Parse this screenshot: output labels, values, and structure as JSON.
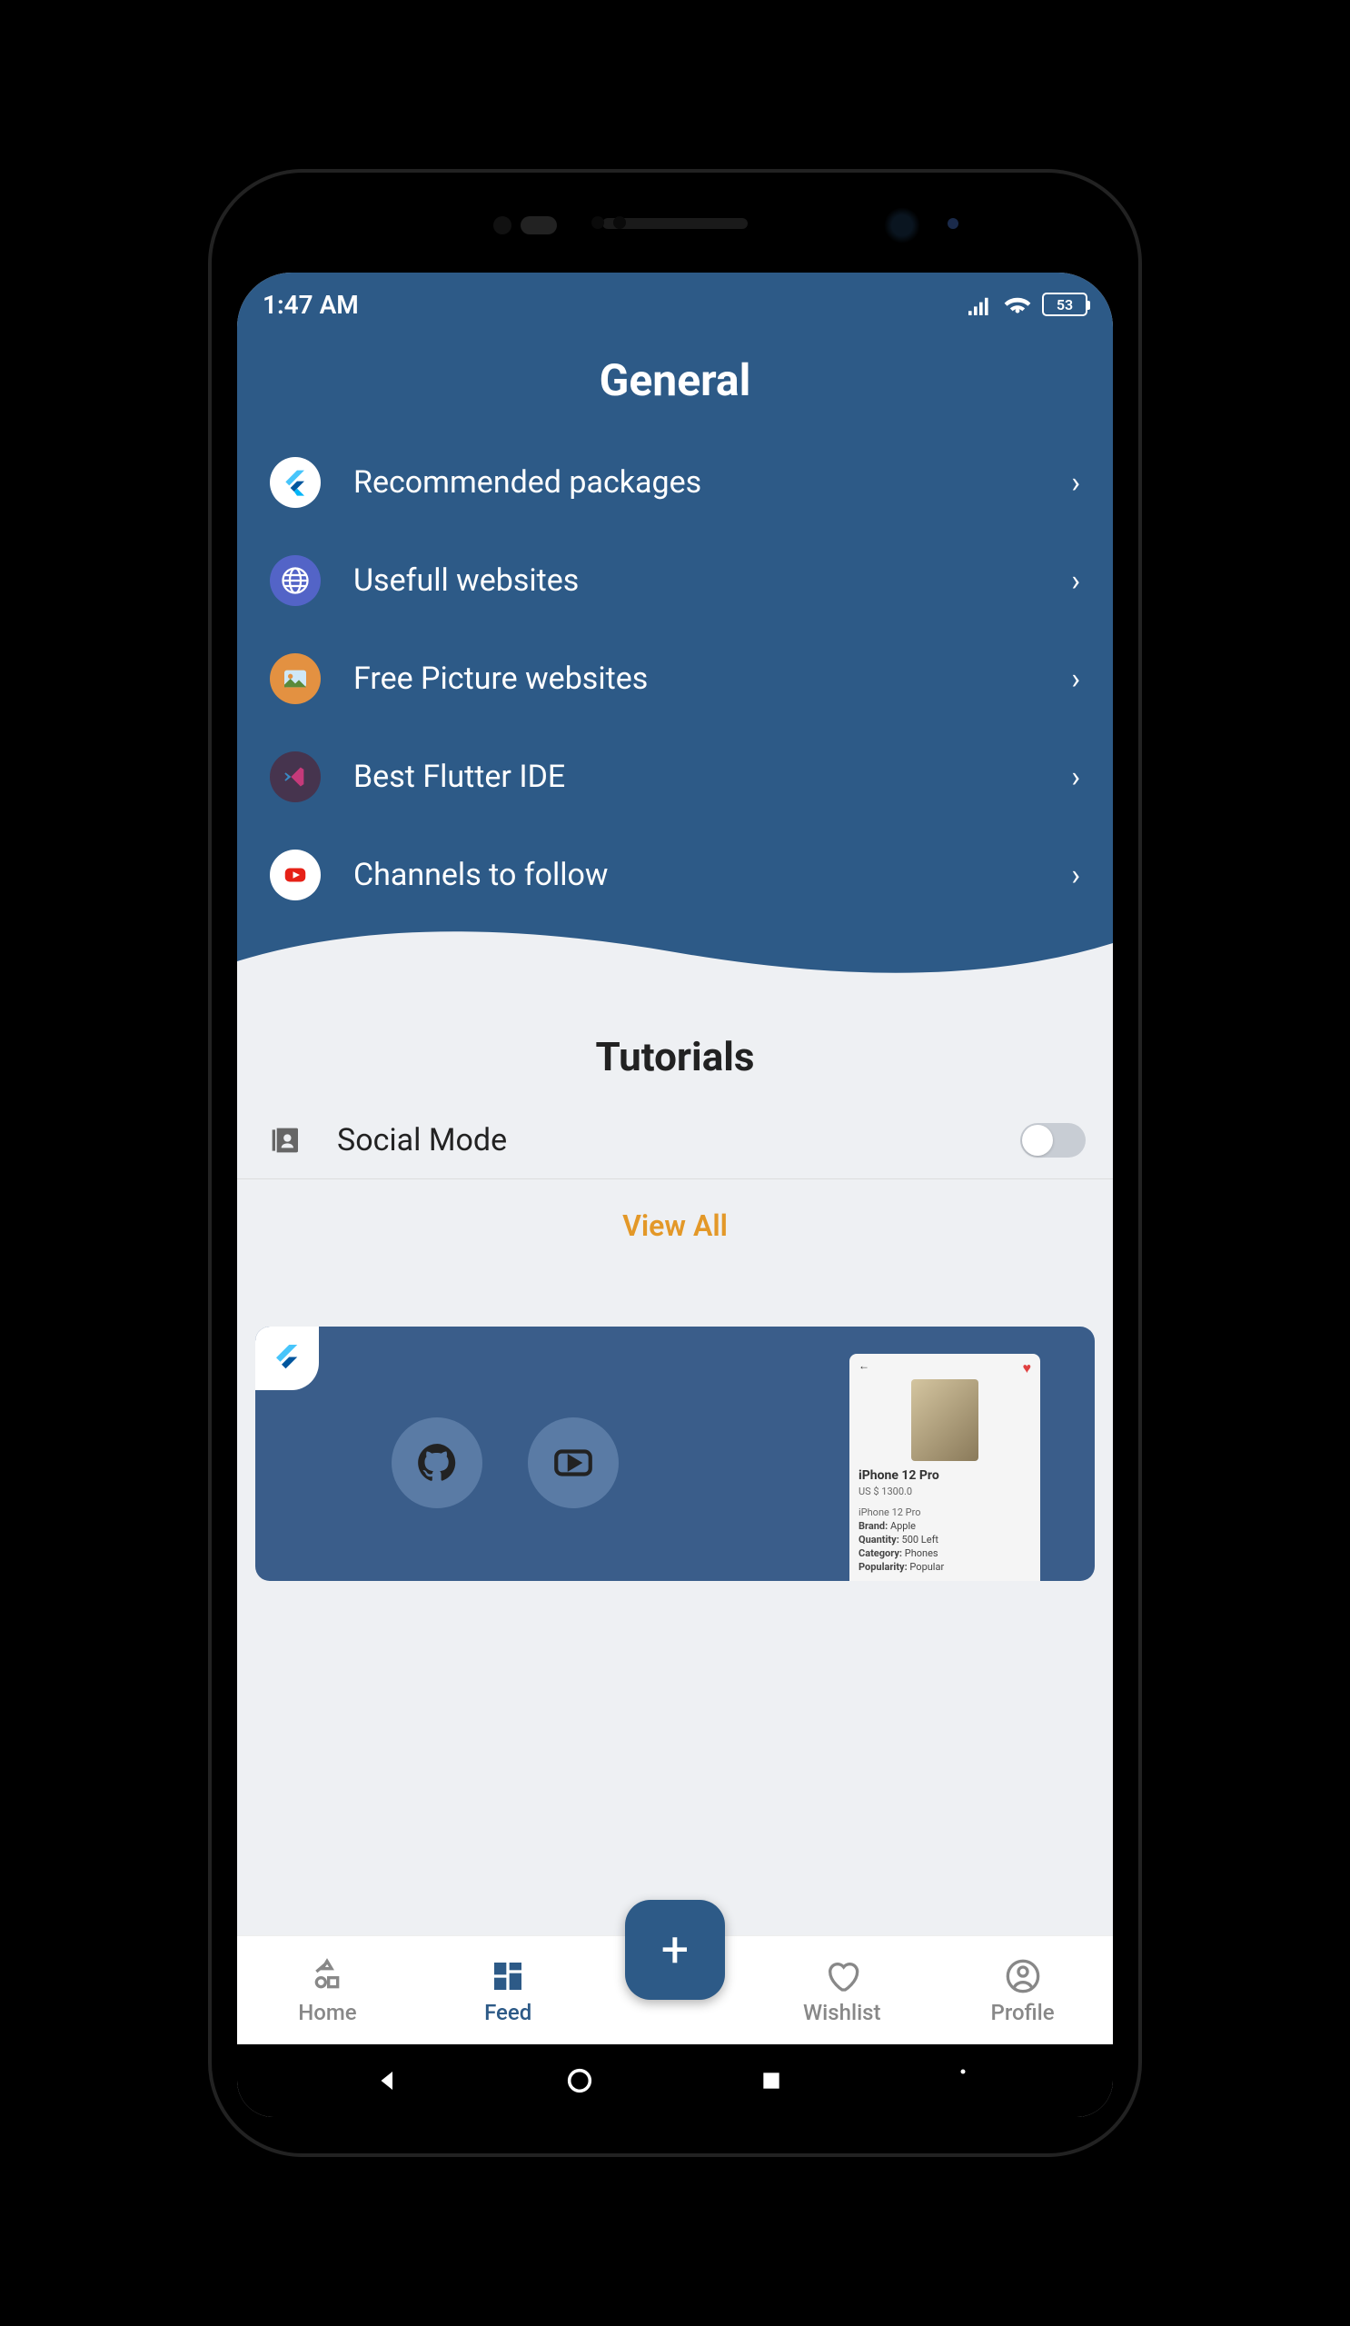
{
  "status": {
    "time": "1:47 AM",
    "battery": "53"
  },
  "general": {
    "title": "General",
    "items": [
      {
        "label": "Recommended packages",
        "icon": "flutter",
        "bg": "#ffffff"
      },
      {
        "label": "Usefull websites",
        "icon": "globe",
        "bg": "#5364c7"
      },
      {
        "label": "Free Picture websites",
        "icon": "picture",
        "bg": "#e39141"
      },
      {
        "label": "Best Flutter IDE",
        "icon": "vscode",
        "bg": "#46344e"
      },
      {
        "label": "Channels to follow",
        "icon": "youtube",
        "bg": "#ffffff"
      }
    ]
  },
  "tutorials": {
    "title": "Tutorials",
    "social": {
      "label": "Social Mode",
      "on": false
    },
    "view_all": "View All",
    "card": {
      "product_title": "iPhone 12 Pro",
      "product_price": "US $ 1300.0",
      "product_sub": "iPhone 12 Pro",
      "brand_label": "Brand:",
      "brand_val": "Apple",
      "qty_label": "Quantity:",
      "qty_val": "500 Left",
      "cat_label": "Category:",
      "cat_val": "Phones",
      "pop_label": "Popularity:",
      "pop_val": "Popular"
    }
  },
  "nav": {
    "home": "Home",
    "feed": "Feed",
    "wishlist": "Wishlist",
    "profile": "Profile",
    "fab": "+"
  }
}
